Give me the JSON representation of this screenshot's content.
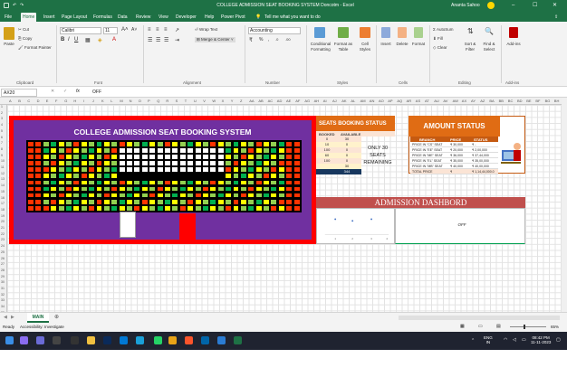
{
  "window": {
    "title": "COLLEGE ADMISSION SEAT BOOKING SYSTEM Doncotm  -  Excel",
    "user": "Ananta Sahoo"
  },
  "menu": [
    "File",
    "Home",
    "Insert",
    "Page Layout",
    "Formulas",
    "Data",
    "Review",
    "View",
    "Developer",
    "Help",
    "Power Pivot"
  ],
  "tell_me": "Tell me what you want to do",
  "share": "Share",
  "ribbon": {
    "clipboard": {
      "paste": "Paste",
      "cut": "Cut",
      "copy": "Copy",
      "format_painter": "Format Painter",
      "label": "Clipboard"
    },
    "font": {
      "name": "Calibri",
      "size": "11",
      "label": "Font"
    },
    "alignment": {
      "wrap": "Wrap Text",
      "merge": "Merge & Center",
      "label": "Alignment"
    },
    "number": {
      "format": "Accounting",
      "label": "Number"
    },
    "styles": {
      "conditional": "Conditional Formatting",
      "format_as_table": "Format as Table",
      "cell_styles": "Cell Styles",
      "label": "Styles"
    },
    "cells": {
      "insert": "Insert",
      "delete": "Delete",
      "format": "Format",
      "label": "Cells"
    },
    "editing": {
      "autosum": "AutoSum",
      "fill": "Fill",
      "clear": "Clear",
      "sort": "Sort & Filter",
      "find": "Find & Select",
      "label": "Editing"
    },
    "addins": {
      "label": "Add-ins",
      "button": "Add-ins"
    }
  },
  "formula_bar": {
    "name_box": "AX20",
    "content": "OFF"
  },
  "sheet": {
    "booking_title": "COLLEGE ADMISSION SEAT BOOKING SYSTEM",
    "seats_status": {
      "title": "SEATS BOOKING STATUS",
      "col_booked": "BOOKED",
      "col_available": "AVAILABLE",
      "rows": [
        {
          "booked": "0",
          "available": "30"
        },
        {
          "booked": "10",
          "available": "0"
        },
        {
          "booked": "100",
          "available": "0"
        },
        {
          "booked": "60",
          "available": "0"
        },
        {
          "booked": "100",
          "available": "0"
        },
        {
          "booked": "",
          "available": "30"
        },
        {
          "booked": "",
          "available": "344"
        }
      ],
      "remaining": "ONLY 30 SEATS REMAINING"
    },
    "amount_status": {
      "title": "AMOUNT STATUS",
      "col_branch": "BRANCH",
      "col_price": "PRICE",
      "col_status": "STATUS",
      "rows": [
        {
          "branch": "PRICE IN \"CS\" SEAT",
          "price": "₹ 30,000",
          "status": "₹ -"
        },
        {
          "branch": "PRICE IN \"EE\" SEAT",
          "price": "₹ 20,000",
          "status": "₹ 2,00,000"
        },
        {
          "branch": "PRICE IN \"ME\" SEAT",
          "price": "₹ 36,000",
          "status": "₹ 37,44,000"
        },
        {
          "branch": "PRICE IN \"EL\" SEAT",
          "price": "₹ 35,000",
          "status": "₹ 35,00,000"
        },
        {
          "branch": "PRICE IN \"MB\" SEAT",
          "price": "₹ 40,000",
          "status": "₹ 40,00,000"
        },
        {
          "branch": "TOTAL PRICE",
          "price": "₹",
          "status": "₹ 1,14,44,000.0"
        }
      ]
    },
    "dashboard": {
      "title": "ADMISSION DASHBORD",
      "value": "OFF",
      "axis_ticks": [
        "1",
        "2",
        "3",
        "4"
      ]
    },
    "tab": "MAIN"
  },
  "status_bar": {
    "ready": "Ready",
    "accessibility": "Accessibility: Investigate",
    "zoom": "65%"
  },
  "taskbar": {
    "lang1": "ENG",
    "lang2": "IN",
    "time": "08:42 PM",
    "date": "11-11-2023"
  },
  "colors": {
    "excel_green": "#1e7145",
    "booking_border": "#ff0000",
    "booking_bg": "#7030a0",
    "orange": "#e06c14",
    "dashboard": "#c0504d"
  }
}
